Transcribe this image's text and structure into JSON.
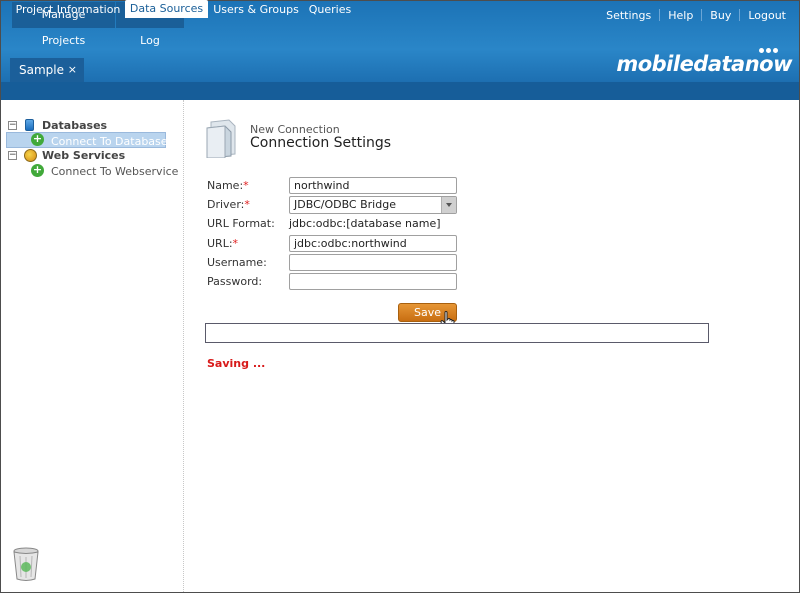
{
  "top_nav": {
    "manage_projects": "Manage Projects",
    "event_log": "Event Log",
    "links": [
      "Settings",
      "Help",
      "Buy",
      "Logout"
    ]
  },
  "file_tab": {
    "label": "Sample",
    "close": "×"
  },
  "logo": {
    "text": "mobiledatanow"
  },
  "tabs": [
    {
      "label": "Project Information",
      "active": false
    },
    {
      "label": "Data Sources",
      "active": true
    },
    {
      "label": "Users & Groups",
      "active": false
    },
    {
      "label": "Queries",
      "active": false
    }
  ],
  "tree": {
    "databases": {
      "label": "Databases",
      "expander": "⊟",
      "child": "Connect To Database"
    },
    "web_services": {
      "label": "Web Services",
      "expander": "⊟",
      "child": "Connect To Webservice"
    }
  },
  "form": {
    "header_small": "New Connection",
    "header_large": "Connection Settings",
    "name_label": "Name:",
    "name_value": "northwind",
    "driver_label": "Driver:",
    "driver_value": "JDBC/ODBC Bridge",
    "url_format_label": "URL Format:",
    "url_format_value": "jdbc:odbc:[database name]",
    "url_label": "URL:",
    "url_value": "jdbc:odbc:northwind",
    "username_label": "Username:",
    "username_value": "",
    "password_label": "Password:",
    "password_value": "",
    "required_mark": "*",
    "save_label": "Save"
  },
  "status": {
    "saving": "Saving ..."
  },
  "colors": {
    "header_blue": "#2a86c8",
    "nav_blue": "#165d99",
    "save_orange": "#d9821f",
    "error_red": "#d81a1a"
  }
}
